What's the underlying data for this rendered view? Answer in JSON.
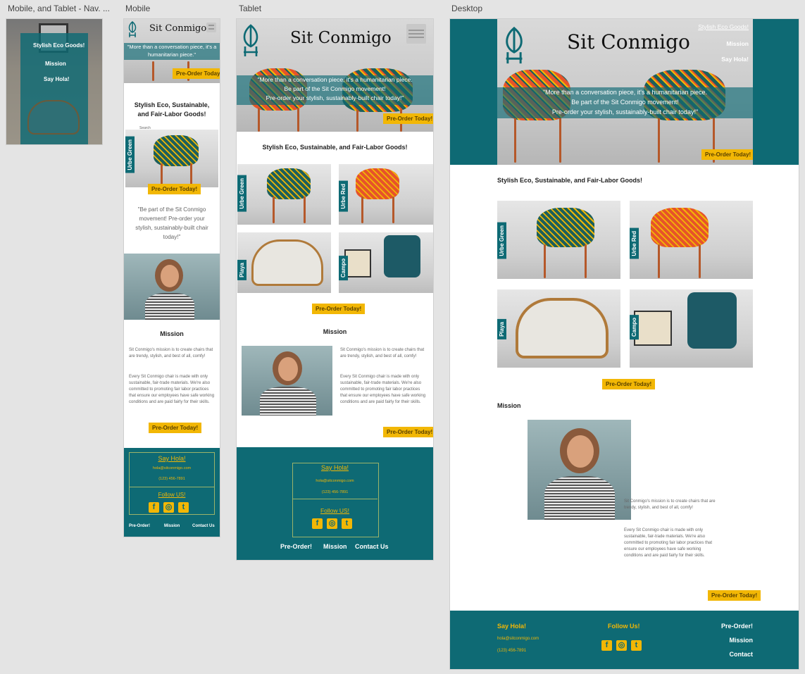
{
  "artboards": {
    "nav": "Mobile, and Tablet - Nav. ...",
    "mobile": "Mobile",
    "tablet": "Tablet",
    "desktop": "Desktop"
  },
  "brand": "Sit Conmigo",
  "nav_links": [
    "Stylish Eco Goods!",
    "Mission",
    "Say Hola!"
  ],
  "hero": {
    "quote_mobile": "\"More than a conversation piece, it's a humanitarian piece.\"",
    "quote_full_1": "\"More than a conversation piece, it's a humanitarian piece.",
    "quote_full_2": "Be part of the Sit Conmigo movement!",
    "quote_full_3": "Pre-order your stylish, sustainably-built chair today!\""
  },
  "cta": "Pre-Order Today!",
  "goods_heading": "Stylish Eco, Sustainable, and Fair-Labor Goods!",
  "products": [
    "Urbe Green",
    "Urbe Red",
    "Playa",
    "Campo"
  ],
  "mobile_quote": "\"Be part of the Sit Conmigo movement! Pre-order your stylish, sustainably-built chair today!\"",
  "mobile_search": "Search",
  "mission": {
    "heading": "Mission",
    "p1": "Sit Conmigo's mission is to create chairs that are trendy, stylish, and best of all, comfy!",
    "p2": "Every Sit Conmigo chair is made with only sustainable, fair-trade materials. We're also committed to promoting fair labor practices that ensure our employees have safe working conditions and are paid fairly for their skills."
  },
  "footer": {
    "say_hola": "Say Hola!",
    "email": "hola@sitconmigo.com",
    "phone": "(123) 456-7891",
    "follow": "Follow US!",
    "follow_desktop": "Follow Us!",
    "links": [
      "Pre-Order!",
      "Mission",
      "Contact Us"
    ],
    "links_desktop": [
      "Pre-Order!",
      "Mission",
      "Contact"
    ]
  },
  "social_icons": [
    "facebook-icon",
    "instagram-icon",
    "tumblr-icon"
  ],
  "social_glyphs": [
    "f",
    "◎",
    "t"
  ],
  "colors": {
    "teal": "#0e6a74",
    "gold": "#f2b705"
  }
}
